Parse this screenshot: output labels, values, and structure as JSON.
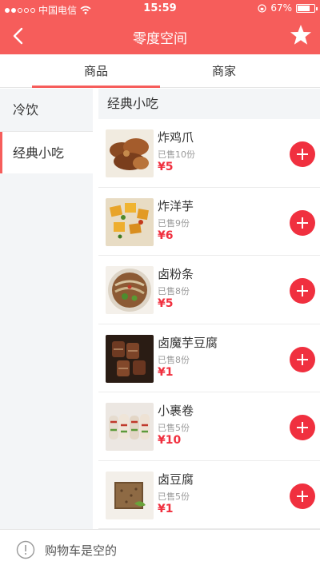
{
  "status_bar": {
    "carrier": "中国电信",
    "time": "15:59",
    "battery": "67%"
  },
  "nav": {
    "title": "零度空间",
    "back_icon": "back-chevron-icon",
    "star_icon": "star-icon"
  },
  "tabs": [
    {
      "label": "商品",
      "active": true
    },
    {
      "label": "商家",
      "active": false
    }
  ],
  "categories": [
    {
      "label": "冷饮",
      "active": false
    },
    {
      "label": "经典小吃",
      "active": true
    }
  ],
  "section_title": "经典小吃",
  "items": [
    {
      "name": "炸鸡爪",
      "sold": "已售10份",
      "price": "¥5"
    },
    {
      "name": "炸洋芋",
      "sold": "已售9份",
      "price": "¥6"
    },
    {
      "name": "卤粉条",
      "sold": "已售8份",
      "price": "¥5"
    },
    {
      "name": "卤魔芋豆腐",
      "sold": "已售8份",
      "price": "¥1"
    },
    {
      "name": "小裹卷",
      "sold": "已售5份",
      "price": "¥10"
    },
    {
      "name": "卤豆腐",
      "sold": "已售5份",
      "price": "¥1"
    }
  ],
  "cart": {
    "text": "购物车是空的"
  },
  "colors": {
    "accent": "#f65d5b",
    "price": "#f0303f",
    "sidebar_bg": "#f3f5f7"
  }
}
